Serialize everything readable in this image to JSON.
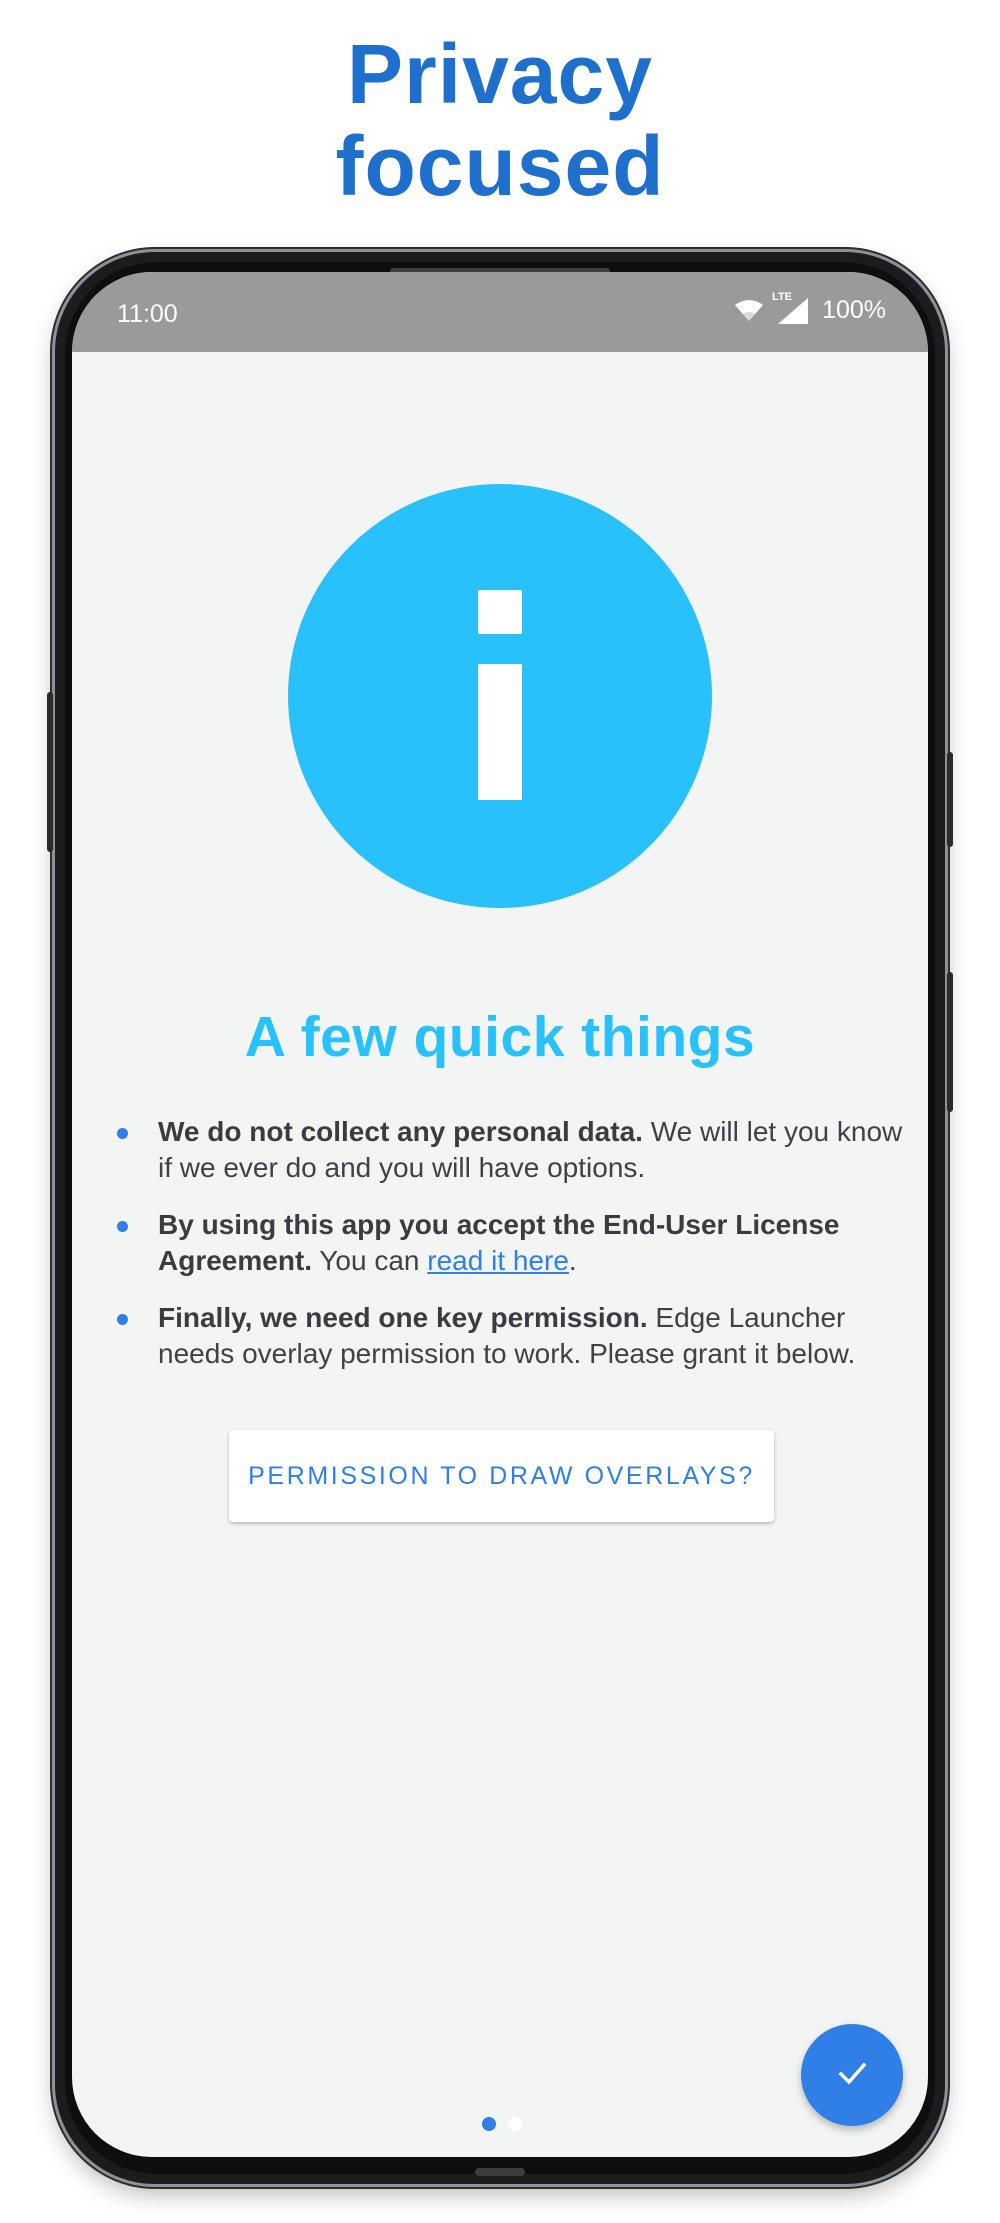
{
  "headline": {
    "line1": "Privacy",
    "line2": "focused"
  },
  "status_bar": {
    "time": "11:00",
    "network": "LTE",
    "battery": "100%",
    "icons": [
      "wifi-icon",
      "signal-icon"
    ]
  },
  "screen": {
    "hero_icon": "info-icon",
    "title": "A few quick things",
    "bullets": [
      {
        "bold": "We do not collect any personal data.",
        "text": " We will let you know if we ever do and you will have options."
      },
      {
        "bold": "By using this app you accept the End-User License Agreement.",
        "text": " You can ",
        "link": "read it here",
        "after": "."
      },
      {
        "bold": "Finally, we need one key permission.",
        "text": " Edge Launcher needs overlay permission to work. Please grant it below."
      }
    ],
    "permission_button": "PERMISSION TO DRAW OVERLAYS?",
    "pager": {
      "total": 2,
      "active": 1
    },
    "fab_icon": "check-icon"
  },
  "colors": {
    "headline": "#1f6fcd",
    "accent": "#29c1fb",
    "link": "#2f7fe6",
    "status_bar": "#9a9a9a",
    "screen_bg": "#f3f4f4"
  }
}
